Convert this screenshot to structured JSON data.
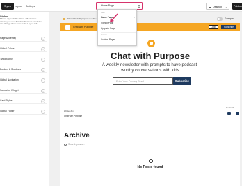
{
  "topbar": {
    "tabs": [
      {
        "label": "Styles",
        "active": true
      },
      {
        "label": "Layout",
        "active": false
      },
      {
        "label": "Settings",
        "active": false
      }
    ],
    "page_selector": {
      "label": "Home Page"
    },
    "device": {
      "label": "Desktop"
    },
    "publish_label": "Publish"
  },
  "left_panel": {
    "title": "Styles",
    "description": "Theme styles defined here will cascade across your site. Set default values used. You can change these later in the Layout tab.",
    "items": [
      "Page & Identity",
      "Global Colors",
      "Typography",
      "Borders & Shadows",
      "Global Navigation",
      "Subscribe Widget",
      "Card Styles",
      "Global Footer"
    ]
  },
  "canvas": {
    "url": "https://chatwithpurpose.beehiiv.com",
    "example_label": "Example Site",
    "site": {
      "name": "Chat with Purpose",
      "login_label": "Login",
      "subscribe_top_label": "Subscribe",
      "hero_title": "Chat with Purpose",
      "hero_subtitle": "A weekly newsletter with prompts to have podcast-worthy conversations with kids",
      "email_placeholder": "Enter Your Primary Email",
      "subscribe_label": "Subscribe",
      "written_by_label": "Written By",
      "author": "Chat with Purpose",
      "connect_label": "Connect",
      "archive_title": "Archive",
      "archive_search_placeholder": "Search posts...",
      "empty_state": "No Posts found"
    }
  },
  "dropdown": {
    "group_main": "Core",
    "items_main": [
      {
        "label": "Home Page",
        "selected": true
      },
      {
        "label": "Signup Page",
        "selected": false
      },
      {
        "label": "Upgrade Page",
        "selected": false
      }
    ],
    "group_custom": "Custom",
    "items_custom": [
      {
        "label": "Custom Pages",
        "selected": false
      }
    ],
    "check_glyph": "✓"
  },
  "colors": {
    "accent_orange": "#f5a623",
    "navy": "#1e3a5f",
    "highlight_pink": "#d6336c"
  }
}
